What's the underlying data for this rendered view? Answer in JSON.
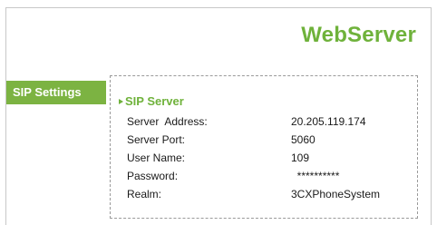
{
  "header": {
    "title": "WebServer"
  },
  "sidebar": {
    "items": [
      {
        "label": "SIP Settings"
      }
    ]
  },
  "sip_server": {
    "title": "SIP Server",
    "fields": [
      {
        "label": "Server  Address:",
        "value": "20.205.119.174"
      },
      {
        "label": "Server Port:",
        "value": "5060"
      },
      {
        "label": "User Name:",
        "value": "109"
      },
      {
        "label": "Password:",
        "value": "  **********"
      },
      {
        "label": "Realm:",
        "value": "3CXPhoneSystem"
      }
    ]
  },
  "colors": {
    "accent": "#7cb342",
    "title": "#6fb23b"
  }
}
